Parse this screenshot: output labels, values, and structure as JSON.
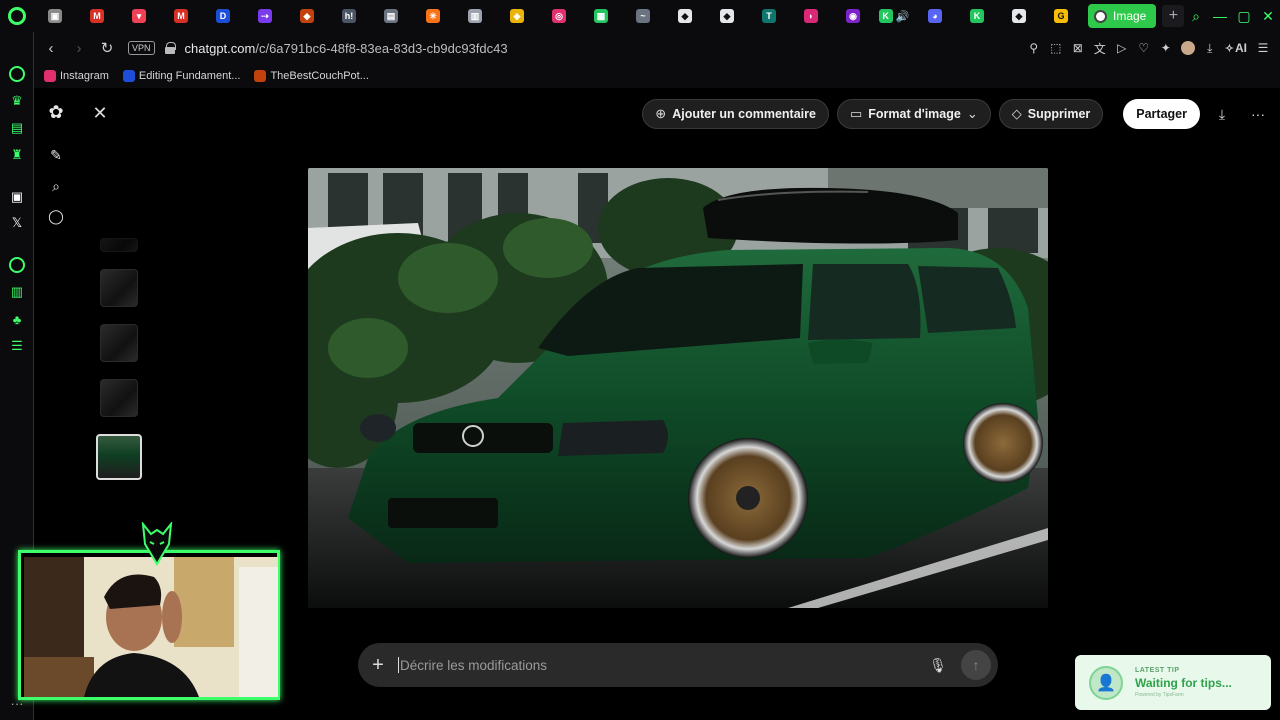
{
  "browser": {
    "tabs": [
      {
        "icon": "gamepad-icon",
        "color": "#8a8a8a",
        "glyph": "▣"
      },
      {
        "icon": "gmail-icon",
        "color": "#d93025",
        "glyph": "M"
      },
      {
        "icon": "pocket-icon",
        "color": "#ef4056",
        "glyph": "▾"
      },
      {
        "icon": "gmail-icon",
        "color": "#d93025",
        "glyph": "M"
      },
      {
        "icon": "docs-icon",
        "color": "#1d4ed8",
        "glyph": "D"
      },
      {
        "icon": "arrow-icon",
        "color": "#7c3aed",
        "glyph": "⇢"
      },
      {
        "icon": "cake-icon",
        "color": "#c2410c",
        "glyph": "◆"
      },
      {
        "icon": "h-icon",
        "color": "#4b5563",
        "glyph": "h!"
      },
      {
        "icon": "disk-icon",
        "color": "#6b7280",
        "glyph": "▤"
      },
      {
        "icon": "spark-icon",
        "color": "#f97316",
        "glyph": "✳"
      },
      {
        "icon": "box-icon",
        "color": "#9ca3af",
        "glyph": "▥"
      },
      {
        "icon": "shield-icon",
        "color": "#eab308",
        "glyph": "◈"
      },
      {
        "icon": "instagram-icon",
        "color": "#e1306c",
        "glyph": "◎"
      },
      {
        "icon": "grid-icon",
        "color": "#22c55e",
        "glyph": "▦"
      },
      {
        "icon": "tilde-icon",
        "color": "#6b7280",
        "glyph": "~"
      },
      {
        "icon": "tag-icon",
        "color": "#e5e7eb",
        "glyph": "◆"
      },
      {
        "icon": "tag-icon",
        "color": "#e5e7eb",
        "glyph": "◆"
      },
      {
        "icon": "t-icon",
        "color": "#0f766e",
        "glyph": "T"
      },
      {
        "icon": "bookmark-icon",
        "color": "#db2777",
        "glyph": "◗"
      },
      {
        "icon": "circle-icon",
        "color": "#7e22ce",
        "glyph": "◉"
      }
    ],
    "audio_tab": {
      "icon": "k-icon",
      "color": "#22c55e",
      "glyph": "K"
    },
    "more_tabs": [
      {
        "icon": "discord-icon",
        "color": "#5865f2",
        "glyph": "◕"
      },
      {
        "icon": "k-icon",
        "color": "#22c55e",
        "glyph": "K"
      },
      {
        "icon": "tag-icon",
        "color": "#e5e7eb",
        "glyph": "◆"
      },
      {
        "icon": "google-icon",
        "color": "#fbbc05",
        "glyph": "G"
      }
    ],
    "active_tab": {
      "label": "Image"
    },
    "url": {
      "host": "chatgpt.com",
      "path": "/c/6a791bc6-48f8-83ea-83d3-cb9dc93fdc43"
    },
    "vpn_label": "VPN",
    "ai_label": "AI",
    "bookmarks": [
      {
        "label": "Instagram",
        "color": "#e1306c"
      },
      {
        "label": "Editing Fundament...",
        "color": "#1d4ed8"
      },
      {
        "label": "TheBestCouchPot...",
        "color": "#c2410c"
      }
    ]
  },
  "editor": {
    "actions": {
      "comment": "Ajouter un commentaire",
      "format": "Format d'image",
      "delete": "Supprimer",
      "share": "Partager"
    },
    "composer_placeholder": "Décrire les modifications"
  },
  "tip": {
    "label": "LATEST TIP",
    "message": "Waiting for tips...",
    "powered": "Powered by TipsFarm"
  }
}
